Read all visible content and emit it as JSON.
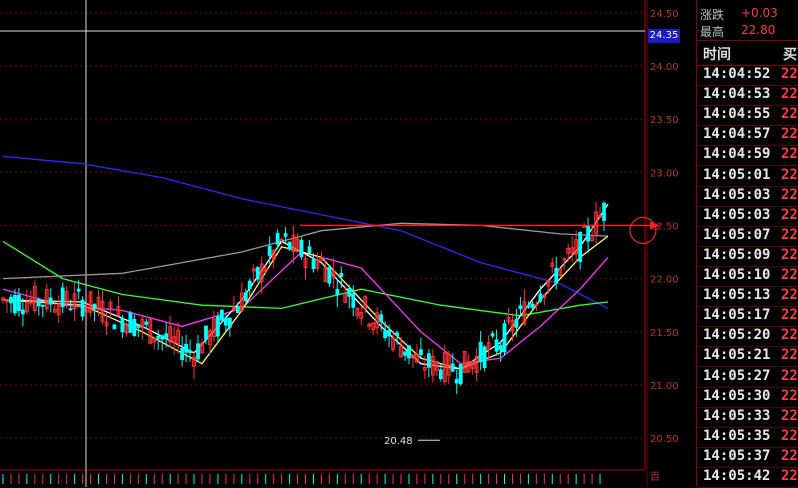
{
  "chart_data": {
    "type": "candlestick",
    "y_axis": {
      "ticks": [
        "24.50",
        "24.00",
        "23.50",
        "23.00",
        "22.50",
        "22.00",
        "21.50",
        "21.00",
        "20.50"
      ],
      "range": [
        20.2,
        24.62
      ]
    },
    "x_count": 152,
    "current_price_tag": "24.35",
    "annotation_low": "20.48",
    "axis_footer": "百",
    "colors": {
      "up": "#ff3333",
      "down": "#00ffff",
      "ma_white": "#ffffff",
      "ma_yellow": "#ffff66",
      "ma_magenta": "#ff33ff",
      "ma_green": "#33ff33",
      "ma_gray": "#9a9a9a",
      "ma_blue": "#2a2aff",
      "grid": "#7a0000",
      "horizontal_line": "#ff2020"
    },
    "horizontal_line_price": 22.5,
    "ma_blue_points": [
      [
        0,
        23.15
      ],
      [
        20,
        23.08
      ],
      [
        40,
        22.95
      ],
      [
        60,
        22.75
      ],
      [
        80,
        22.6
      ],
      [
        100,
        22.45
      ],
      [
        120,
        22.15
      ],
      [
        140,
        21.95
      ],
      [
        152,
        21.72
      ]
    ],
    "ma_gray_points": [
      [
        0,
        22.0
      ],
      [
        30,
        22.05
      ],
      [
        60,
        22.25
      ],
      [
        80,
        22.45
      ],
      [
        100,
        22.52
      ],
      [
        120,
        22.5
      ],
      [
        140,
        22.42
      ],
      [
        152,
        22.4
      ]
    ],
    "ma_green_points": [
      [
        0,
        22.35
      ],
      [
        15,
        22.0
      ],
      [
        30,
        21.85
      ],
      [
        50,
        21.75
      ],
      [
        70,
        21.72
      ],
      [
        90,
        21.9
      ],
      [
        110,
        21.75
      ],
      [
        130,
        21.65
      ],
      [
        145,
        21.75
      ],
      [
        152,
        21.78
      ]
    ],
    "ma_magenta_points": [
      [
        0,
        21.9
      ],
      [
        15,
        21.75
      ],
      [
        30,
        21.7
      ],
      [
        45,
        21.55
      ],
      [
        60,
        21.72
      ],
      [
        75,
        22.25
      ],
      [
        90,
        22.1
      ],
      [
        105,
        21.5
      ],
      [
        115,
        21.2
      ],
      [
        125,
        21.25
      ],
      [
        135,
        21.55
      ],
      [
        145,
        21.9
      ],
      [
        152,
        22.2
      ]
    ],
    "ma_yellow_points": [
      [
        0,
        21.8
      ],
      [
        20,
        21.75
      ],
      [
        35,
        21.5
      ],
      [
        50,
        21.2
      ],
      [
        60,
        21.7
      ],
      [
        70,
        22.3
      ],
      [
        80,
        22.2
      ],
      [
        95,
        21.6
      ],
      [
        105,
        21.25
      ],
      [
        115,
        21.15
      ],
      [
        125,
        21.3
      ],
      [
        135,
        21.8
      ],
      [
        145,
        22.2
      ],
      [
        152,
        22.4
      ]
    ],
    "ma_white_points": [
      [
        0,
        21.8
      ],
      [
        20,
        21.78
      ],
      [
        35,
        21.55
      ],
      [
        48,
        21.3
      ],
      [
        60,
        21.8
      ],
      [
        70,
        22.35
      ],
      [
        80,
        22.15
      ],
      [
        95,
        21.55
      ],
      [
        105,
        21.2
      ],
      [
        115,
        21.15
      ],
      [
        125,
        21.4
      ],
      [
        135,
        21.9
      ],
      [
        145,
        22.3
      ],
      [
        152,
        22.7
      ]
    ]
  },
  "panel": {
    "row1_label": "涨跌",
    "row1_value": "+0.03",
    "row2_label": "最高",
    "row2_value": "22.80",
    "header_time": "时间",
    "header_buy": "买"
  },
  "trades": [
    {
      "time": "14:04:52",
      "price": "22"
    },
    {
      "time": "14:04:53",
      "price": "22"
    },
    {
      "time": "14:04:55",
      "price": "22"
    },
    {
      "time": "14:04:57",
      "price": "22"
    },
    {
      "time": "14:04:59",
      "price": "22"
    },
    {
      "time": "14:05:01",
      "price": "22"
    },
    {
      "time": "14:05:03",
      "price": "22"
    },
    {
      "time": "14:05:03",
      "price": "22"
    },
    {
      "time": "14:05:07",
      "price": "22"
    },
    {
      "time": "14:05:09",
      "price": "22"
    },
    {
      "time": "14:05:10",
      "price": "22"
    },
    {
      "time": "14:05:13",
      "price": "22"
    },
    {
      "time": "14:05:17",
      "price": "22"
    },
    {
      "time": "14:05:20",
      "price": "22"
    },
    {
      "time": "14:05:21",
      "price": "22"
    },
    {
      "time": "14:05:27",
      "price": "22"
    },
    {
      "time": "14:05:30",
      "price": "22"
    },
    {
      "time": "14:05:33",
      "price": "22"
    },
    {
      "time": "14:05:35",
      "price": "22"
    },
    {
      "time": "14:05:37",
      "price": "22"
    },
    {
      "time": "14:05:42",
      "price": "22"
    }
  ]
}
